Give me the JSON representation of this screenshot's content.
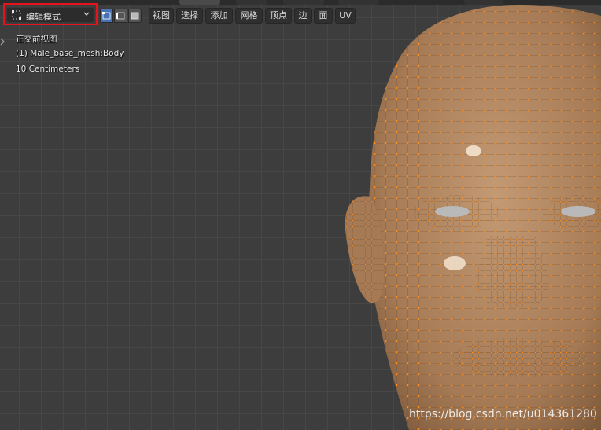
{
  "header": {
    "mode": {
      "label": "编辑模式",
      "icon": "edit-mode-icon"
    },
    "select_modes": [
      {
        "name": "vertex-select-mode-icon",
        "active": true
      },
      {
        "name": "edge-select-mode-icon",
        "active": false
      },
      {
        "name": "face-select-mode-icon",
        "active": false
      }
    ],
    "menus": [
      "视图",
      "选择",
      "添加",
      "网格",
      "顶点",
      "边",
      "面",
      "UV"
    ]
  },
  "overlay": {
    "view_name": "正交前视图",
    "object_name": "(1) Male_base_mesh:Body",
    "grid_scale": "10 Centimeters"
  },
  "watermark": "https://blog.csdn.net/u014361280",
  "colors": {
    "viewport_bg": "#3d3d3d",
    "grid_line": "#474747",
    "mesh_face": "#b08662",
    "vertex": "#ff8c1a",
    "highlight_box": "#e8121c",
    "active_select": "#4772b3"
  }
}
